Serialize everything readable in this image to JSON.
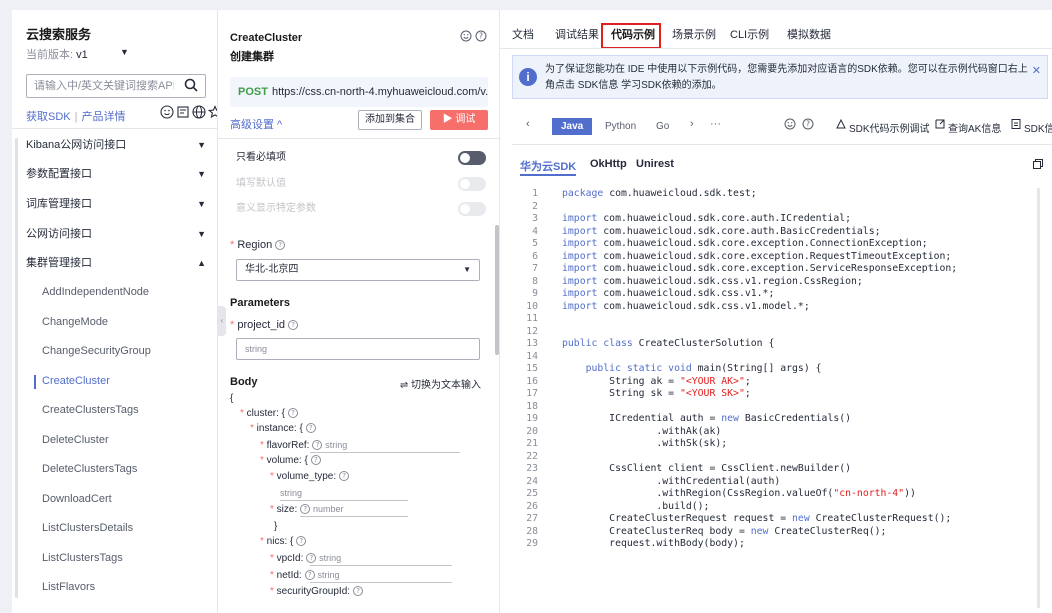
{
  "sidebar": {
    "title": "云搜索服务",
    "version_label": "当前版本:",
    "version_value": "v1",
    "search_placeholder": "请输入中/英文关键词搜索API",
    "link_sdk": "获取SDK",
    "link_sep": "|",
    "link_product": "产品详情",
    "groups": [
      "Kibana公网访问接口",
      "参数配置接口",
      "词库管理接口",
      "公网访问接口",
      "集群管理接口"
    ],
    "apis": [
      "AddIndependentNode",
      "ChangeMode",
      "ChangeSecurityGroup",
      "CreateCluster",
      "CreateClustersTags",
      "DeleteCluster",
      "DeleteClustersTags",
      "DownloadCert",
      "ListClustersDetails",
      "ListClustersTags",
      "ListFlavors"
    ]
  },
  "middle": {
    "api_name": "CreateCluster",
    "api_subtitle": "创建集群",
    "method": "POST",
    "url": "https://css.cn-north-4.myhuaweicloud.com/v...",
    "advanced": "高级设置 ^",
    "add_btn": "添加到集合",
    "debug_btn": "▶ 调试",
    "toggles": [
      "只看必填项",
      "填写默认值",
      "意义显示特定参数"
    ],
    "region_label": "Region",
    "region_value": "华北-北京四",
    "params_heading": "Parameters",
    "project_id_label": "project_id",
    "project_id_placeholder": "string",
    "body_heading": "Body",
    "body_switch": "⇌ 切换为文本输入",
    "tree": {
      "brace_open": "{",
      "cluster": "cluster: {",
      "instance": "instance: {",
      "flavorRef": "flavorRef:",
      "volume": "volume: {",
      "volume_type": "volume_type:",
      "size": "size:",
      "brace_close": "}",
      "nics": "nics: {",
      "vpcId": "vpcId:",
      "netId": "netId:",
      "securityGroupId": "securityGroupId:",
      "hint_string": "string",
      "hint_number": "number"
    }
  },
  "right": {
    "tabs": [
      "文档",
      "调试结果",
      "代码示例",
      "场景示例",
      "CLI示例",
      "模拟数据"
    ],
    "active_tab": "代码示例",
    "notice_text": "为了保证您能功在 IDE 中使用以下示例代码，您需要先添加对应语言的SDK依赖。您可以在示例代码窗口右上角点击 SDK信息 学习SDK依赖的添加。",
    "languages": [
      "Java",
      "Python",
      "Go"
    ],
    "more": "···",
    "sdk_debug": "SDK代码示例调试",
    "query_ak": "查询AK信息",
    "sdk_info": "SDK信息",
    "sdk_tabs": [
      "华为云SDK",
      "OkHttp",
      "Unirest"
    ],
    "code_lines": [
      [
        "1",
        [
          [
            "kw",
            "package"
          ],
          [
            "pl",
            " com.huaweicloud.sdk.test;"
          ]
        ]
      ],
      [
        "2",
        []
      ],
      [
        "3",
        [
          [
            "kw",
            "import"
          ],
          [
            "pl",
            " com.huaweicloud.sdk.core.auth.ICredential;"
          ]
        ]
      ],
      [
        "4",
        [
          [
            "kw",
            "import"
          ],
          [
            "pl",
            " com.huaweicloud.sdk.core.auth.BasicCredentials;"
          ]
        ]
      ],
      [
        "5",
        [
          [
            "kw",
            "import"
          ],
          [
            "pl",
            " com.huaweicloud.sdk.core.exception.ConnectionException;"
          ]
        ]
      ],
      [
        "6",
        [
          [
            "kw",
            "import"
          ],
          [
            "pl",
            " com.huaweicloud.sdk.core.exception.RequestTimeoutException;"
          ]
        ]
      ],
      [
        "7",
        [
          [
            "kw",
            "import"
          ],
          [
            "pl",
            " com.huaweicloud.sdk.core.exception.ServiceResponseException;"
          ]
        ]
      ],
      [
        "8",
        [
          [
            "kw",
            "import"
          ],
          [
            "pl",
            " com.huaweicloud.sdk.css.v1.region.CssRegion;"
          ]
        ]
      ],
      [
        "9",
        [
          [
            "kw",
            "import"
          ],
          [
            "pl",
            " com.huaweicloud.sdk.css.v1.*;"
          ]
        ]
      ],
      [
        "10",
        [
          [
            "kw",
            "import"
          ],
          [
            "pl",
            " com.huaweicloud.sdk.css.v1.model.*;"
          ]
        ]
      ],
      [
        "11",
        []
      ],
      [
        "12",
        []
      ],
      [
        "13",
        [
          [
            "kw",
            "public class"
          ],
          [
            "pl",
            " CreateClusterSolution {"
          ]
        ]
      ],
      [
        "14",
        []
      ],
      [
        "15",
        [
          [
            "pl",
            "    "
          ],
          [
            "kw",
            "public static void"
          ],
          [
            "pl",
            " main(String[] args) {"
          ]
        ]
      ],
      [
        "16",
        [
          [
            "pl",
            "        String ak = "
          ],
          [
            "str",
            "\"<YOUR AK>\""
          ],
          [
            "pl",
            ";"
          ]
        ]
      ],
      [
        "17",
        [
          [
            "pl",
            "        String sk = "
          ],
          [
            "str",
            "\"<YOUR SK>\""
          ],
          [
            "pl",
            ";"
          ]
        ]
      ],
      [
        "18",
        []
      ],
      [
        "19",
        [
          [
            "pl",
            "        ICredential auth = "
          ],
          [
            "kw",
            "new"
          ],
          [
            "pl",
            " BasicCredentials()"
          ]
        ]
      ],
      [
        "20",
        [
          [
            "pl",
            "                .withAk(ak)"
          ]
        ]
      ],
      [
        "21",
        [
          [
            "pl",
            "                .withSk(sk);"
          ]
        ]
      ],
      [
        "22",
        []
      ],
      [
        "23",
        [
          [
            "pl",
            "        CssClient client = CssClient.newBuilder()"
          ]
        ]
      ],
      [
        "24",
        [
          [
            "pl",
            "                .withCredential(auth)"
          ]
        ]
      ],
      [
        "25",
        [
          [
            "pl",
            "                .withRegion(CssRegion.valueOf("
          ],
          [
            "str",
            "\"cn-north-4\""
          ],
          [
            "pl",
            "))"
          ]
        ]
      ],
      [
        "26",
        [
          [
            "pl",
            "                .build();"
          ]
        ]
      ],
      [
        "27",
        [
          [
            "pl",
            "        CreateClusterRequest request = "
          ],
          [
            "kw",
            "new"
          ],
          [
            "pl",
            " CreateClusterRequest();"
          ]
        ]
      ],
      [
        "28",
        [
          [
            "pl",
            "        CreateClusterReq body = "
          ],
          [
            "kw",
            "new"
          ],
          [
            "pl",
            " CreateClusterReq();"
          ]
        ]
      ],
      [
        "29",
        [
          [
            "pl",
            "        request.withBody(body);"
          ]
        ]
      ]
    ]
  }
}
